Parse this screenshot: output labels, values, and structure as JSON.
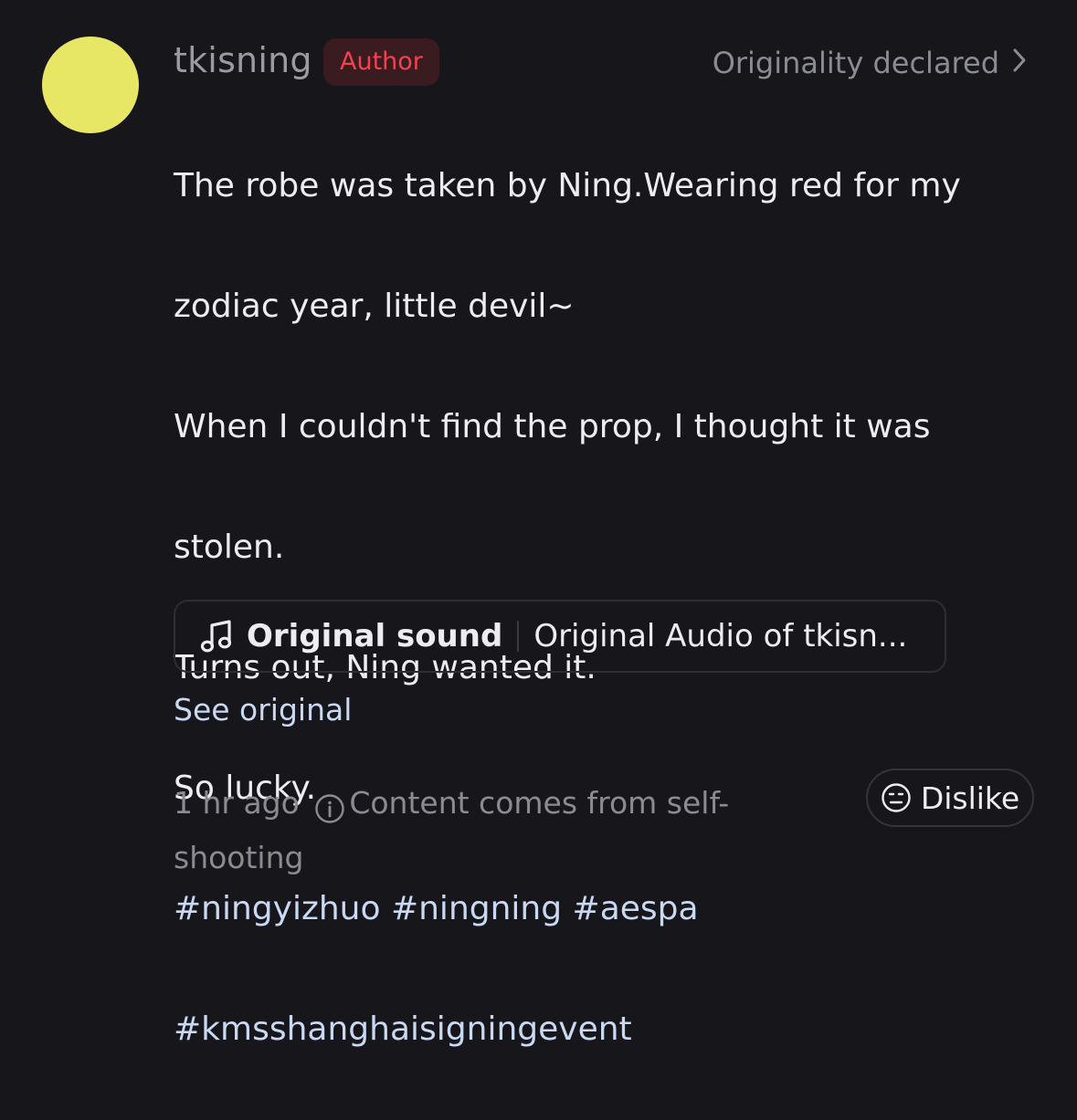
{
  "post": {
    "username": "tkisning",
    "author_badge": "Author",
    "originality": "Originality declared",
    "avatar_color": "#e8e665",
    "content_lines": [
      "The robe was taken by Ning.Wearing red for my",
      "zodiac year, little devil~",
      "When I couldn't find the prop, I thought it was",
      "stolen.",
      "Turns out, Ning wanted it.",
      "So lucky."
    ],
    "hashtags": {
      "line1": "#ningyizhuo #ningning #aespa",
      "line2": "#kmsshanghaisigningevent"
    },
    "sound": {
      "label": "Original sound",
      "title": "Original Audio of tkisn..."
    },
    "see_original": "See original",
    "footer": {
      "time": "1 hr ago",
      "source_note": "Content comes from self-shooting"
    },
    "dislike_label": "Dislike"
  },
  "colors": {
    "background": "#16161b",
    "author_badge_text": "#f1424f",
    "author_badge_bg": "#3a1b20",
    "hashtag": "#c9d8f3"
  },
  "icons": [
    "chevron-right-icon",
    "music-note-icon",
    "info-icon",
    "dislike-face-icon"
  ]
}
